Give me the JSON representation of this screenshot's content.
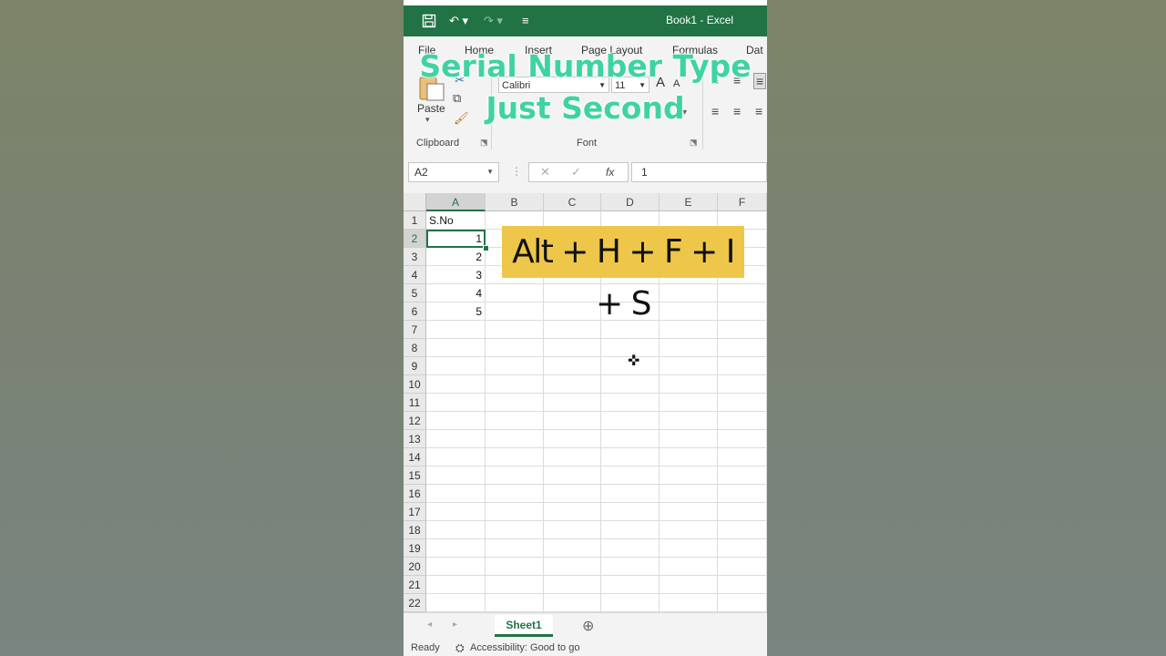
{
  "window": {
    "title": "Book1 - Excel"
  },
  "overlay": {
    "line1": "Serial Number Type",
    "line2": "Just Second"
  },
  "ribbon_tabs": [
    "File",
    "Home",
    "Insert",
    "Page Layout",
    "Formulas",
    "Dat"
  ],
  "ribbon": {
    "paste_label": "Paste",
    "clipboard_label": "Clipboard",
    "font_label": "Font",
    "font_name": "Calibri",
    "font_size": "11"
  },
  "formula_bar": {
    "name_box": "A2",
    "fx": "fx",
    "value": "1"
  },
  "columns": [
    "A",
    "B",
    "C",
    "D",
    "E",
    "F"
  ],
  "rows": [
    "1",
    "2",
    "3",
    "4",
    "5",
    "6",
    "7",
    "8",
    "9",
    "10",
    "11",
    "12",
    "13",
    "14",
    "15",
    "16",
    "17",
    "18",
    "19",
    "20",
    "21",
    "22"
  ],
  "cells": {
    "A1": "S.No",
    "A2": "1",
    "A3": "2",
    "A4": "3",
    "A5": "4",
    "A6": "5"
  },
  "shortcut": "Alt + H + F + I + S",
  "sheet_tab": "Sheet1",
  "status": {
    "ready": "Ready",
    "accessibility": "Accessibility: Good to go"
  },
  "colors": {
    "excel_green": "#217346",
    "overlay_text": "#3fd3a2",
    "shortcut_bg": "#eec74a"
  }
}
